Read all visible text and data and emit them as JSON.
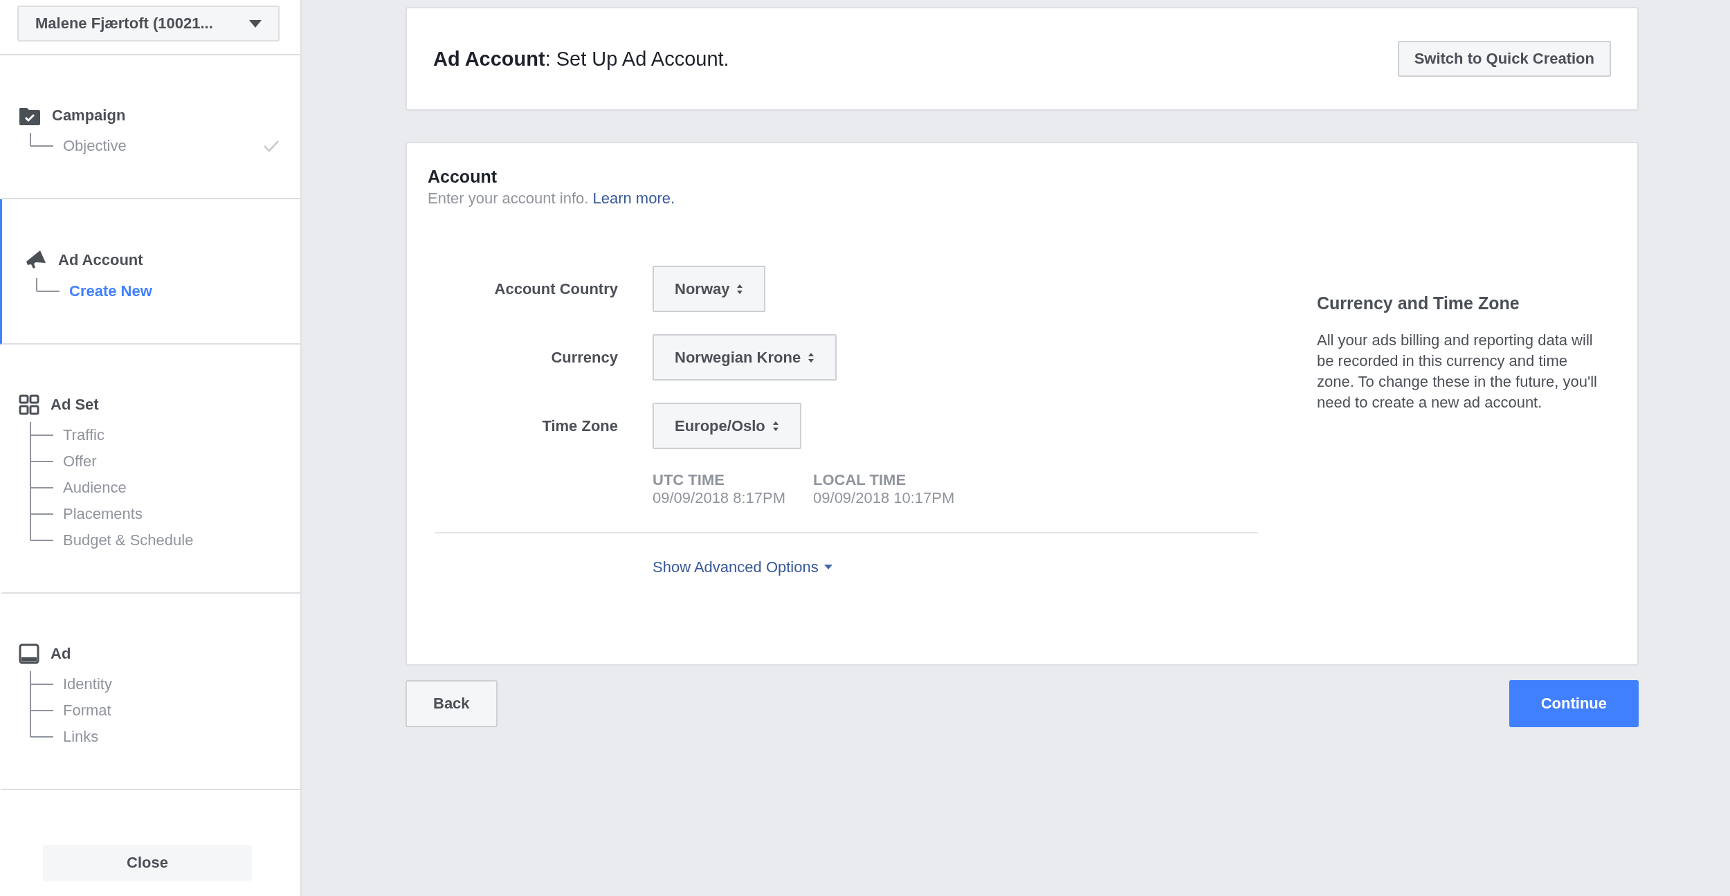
{
  "account_selector": {
    "label": "Malene Fjærtoft (10021..."
  },
  "sidebar": {
    "sections": [
      {
        "kind": "campaign",
        "title": "Campaign",
        "selected": false,
        "items": [
          {
            "label": "Objective",
            "selected": false,
            "done": true
          }
        ]
      },
      {
        "kind": "account",
        "title": "Ad Account",
        "selected": true,
        "items": [
          {
            "label": "Create New",
            "selected": true,
            "done": false
          }
        ]
      },
      {
        "kind": "adset",
        "title": "Ad Set",
        "selected": false,
        "items": [
          {
            "label": "Traffic",
            "selected": false,
            "done": false
          },
          {
            "label": "Offer",
            "selected": false,
            "done": false
          },
          {
            "label": "Audience",
            "selected": false,
            "done": false
          },
          {
            "label": "Placements",
            "selected": false,
            "done": false
          },
          {
            "label": "Budget & Schedule",
            "selected": false,
            "done": false
          }
        ]
      },
      {
        "kind": "ad",
        "title": "Ad",
        "selected": false,
        "items": [
          {
            "label": "Identity",
            "selected": false,
            "done": false
          },
          {
            "label": "Format",
            "selected": false,
            "done": false
          },
          {
            "label": "Links",
            "selected": false,
            "done": false
          }
        ]
      }
    ],
    "close_button": "Close"
  },
  "header": {
    "title": "**Ad Account**: Set Up Ad Account.",
    "quick_button": "Switch to Quick Creation"
  },
  "account_card": {
    "title": "Account",
    "subtitle": "Enter your account info.",
    "link": "Learn more.",
    "fields": [
      {
        "label": "Account Country",
        "value": "Norway"
      },
      {
        "label": "Currency",
        "value": "Norwegian Krone"
      },
      {
        "label": "Time Zone",
        "value": "Europe/Oslo"
      }
    ],
    "times": [
      {
        "label": "UTC TIME",
        "value": "09/09/2018 8:17PM"
      },
      {
        "label": "LOCAL TIME",
        "value": "09/09/2018 10:17PM"
      }
    ],
    "advanced_link": "Show Advanced Options",
    "info": {
      "title": "Currency and Time Zone",
      "text": "All your ads billing and reporting data will be recorded in this currency and time zone. To change these in the future, you'll need to create a new ad account."
    }
  },
  "footer": {
    "back_button": "Back",
    "continue_button": "Continue"
  }
}
